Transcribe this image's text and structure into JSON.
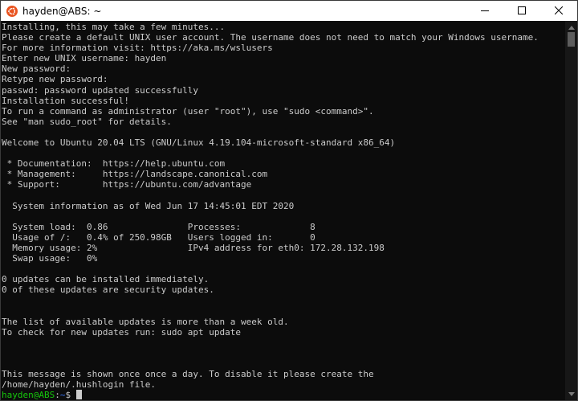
{
  "window": {
    "title": "hayden@ABS: ~",
    "app_icon": "ubuntu-icon",
    "controls": [
      "minimize-icon",
      "maximize-icon",
      "close-icon"
    ]
  },
  "colors": {
    "background": "#0c0c0c",
    "text": "#cccccc",
    "prompt_user": "#16c60c",
    "prompt_path": "#3b78ff",
    "ubuntu_orange": "#e95420"
  },
  "terminal": {
    "lines": [
      "Installing, this may take a few minutes...",
      "Please create a default UNIX user account. The username does not need to match your Windows username.",
      "For more information visit: https://aka.ms/wslusers",
      "Enter new UNIX username: hayden",
      "New password:",
      "Retype new password:",
      "passwd: password updated successfully",
      "Installation successful!",
      "To run a command as administrator (user \"root\"), use \"sudo <command>\".",
      "See \"man sudo_root\" for details.",
      "",
      "Welcome to Ubuntu 20.04 LTS (GNU/Linux 4.19.104-microsoft-standard x86_64)",
      "",
      " * Documentation:  https://help.ubuntu.com",
      " * Management:     https://landscape.canonical.com",
      " * Support:        https://ubuntu.com/advantage",
      "",
      "  System information as of Wed Jun 17 14:45:01 EDT 2020",
      "",
      "  System load:  0.86               Processes:             8",
      "  Usage of /:   0.4% of 250.98GB   Users logged in:       0",
      "  Memory usage: 2%                 IPv4 address for eth0: 172.28.132.198",
      "  Swap usage:   0%",
      "",
      "0 updates can be installed immediately.",
      "0 of these updates are security updates.",
      "",
      "",
      "The list of available updates is more than a week old.",
      "To check for new updates run: sudo apt update",
      "",
      "",
      "",
      "This message is shown once once a day. To disable it please create the",
      "/home/hayden/.hushlogin file."
    ],
    "prompt": {
      "user_host": "hayden@ABS",
      "colon": ":",
      "path": "~",
      "symbol": "$ "
    }
  }
}
